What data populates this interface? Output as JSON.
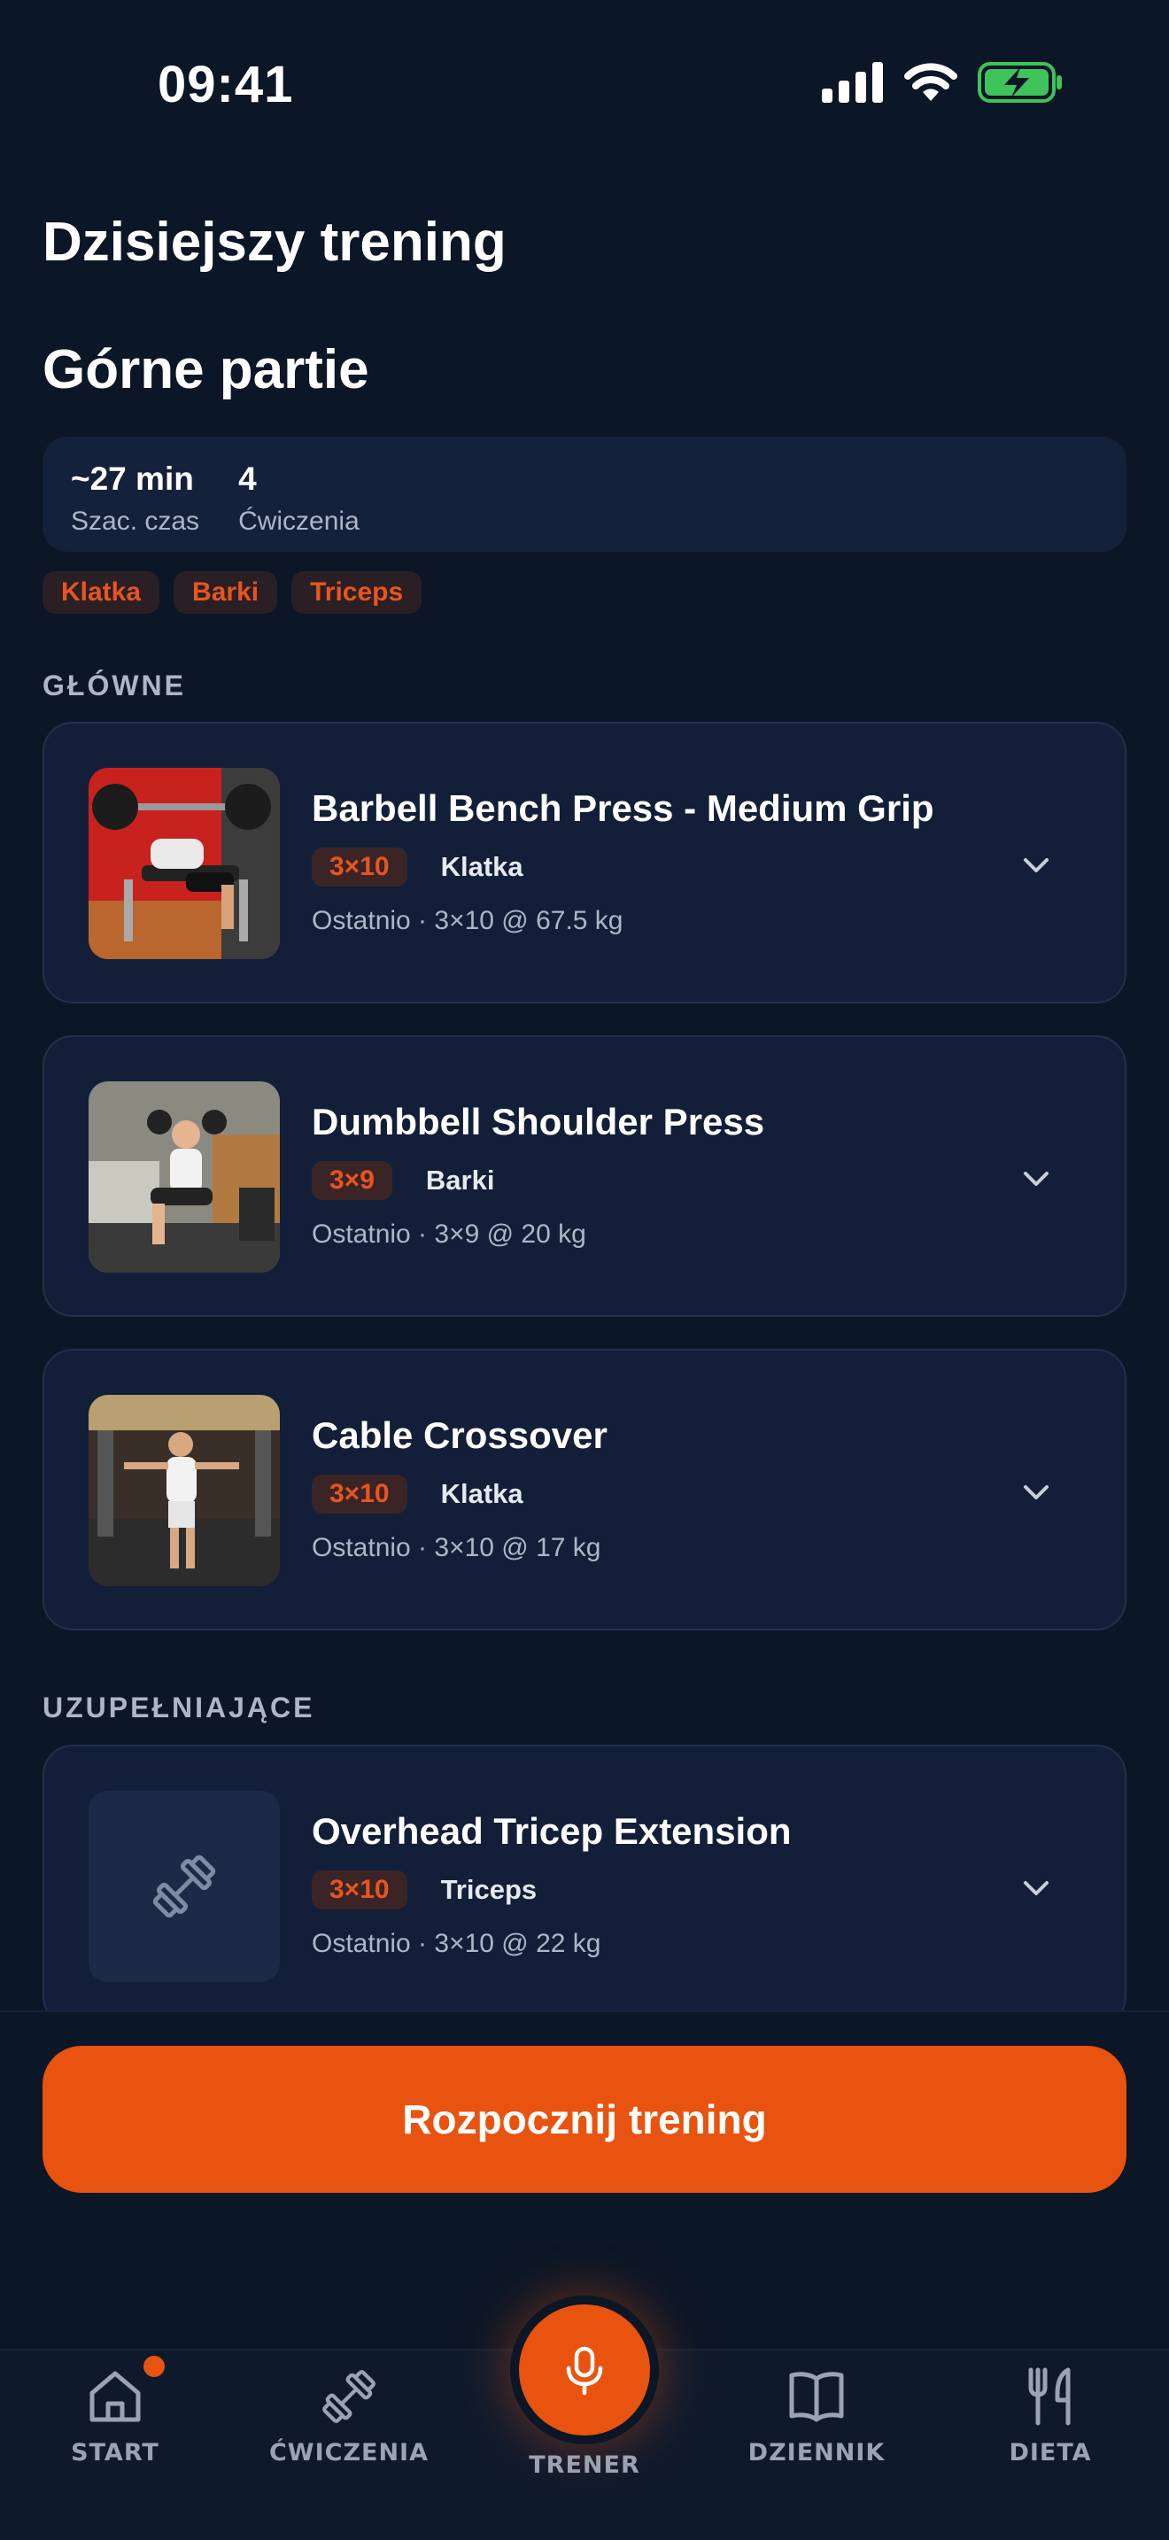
{
  "status_bar": {
    "time": "09:41"
  },
  "header": {
    "title": "Dzisiejszy trening",
    "workout_name": "Górne partie"
  },
  "stats": [
    {
      "value": "~27 min",
      "label": "Szac. czas"
    },
    {
      "value": "4",
      "label": "Ćwiczenia"
    }
  ],
  "tags": [
    "Klatka",
    "Barki",
    "Triceps"
  ],
  "sections": {
    "main": "GŁÓWNE",
    "accessory": "UZUPEŁNIAJĄCE"
  },
  "exercises": [
    {
      "title": "Barbell Bench Press - Medium Grip",
      "sets": "3×10",
      "muscle": "Klatka",
      "last": "Ostatnio · 3×10 @ 67.5 kg"
    },
    {
      "title": "Dumbbell Shoulder Press",
      "sets": "3×9",
      "muscle": "Barki",
      "last": "Ostatnio · 3×9 @ 20 kg"
    },
    {
      "title": "Cable Crossover",
      "sets": "3×10",
      "muscle": "Klatka",
      "last": "Ostatnio · 3×10 @ 17 kg"
    },
    {
      "title": "Overhead Tricep Extension",
      "sets": "3×10",
      "muscle": "Triceps",
      "last": "Ostatnio · 3×10 @ 22 kg"
    }
  ],
  "cta": {
    "label": "Rozpocznij trening"
  },
  "tab_bar": {
    "start": "START",
    "exercises": "ĆWICZENIA",
    "trainer": "TRENER",
    "journal": "DZIENNIK",
    "diet": "DIETA"
  },
  "colors": {
    "accent": "#e8530f",
    "background": "#0b1626",
    "card": "#131f38"
  }
}
